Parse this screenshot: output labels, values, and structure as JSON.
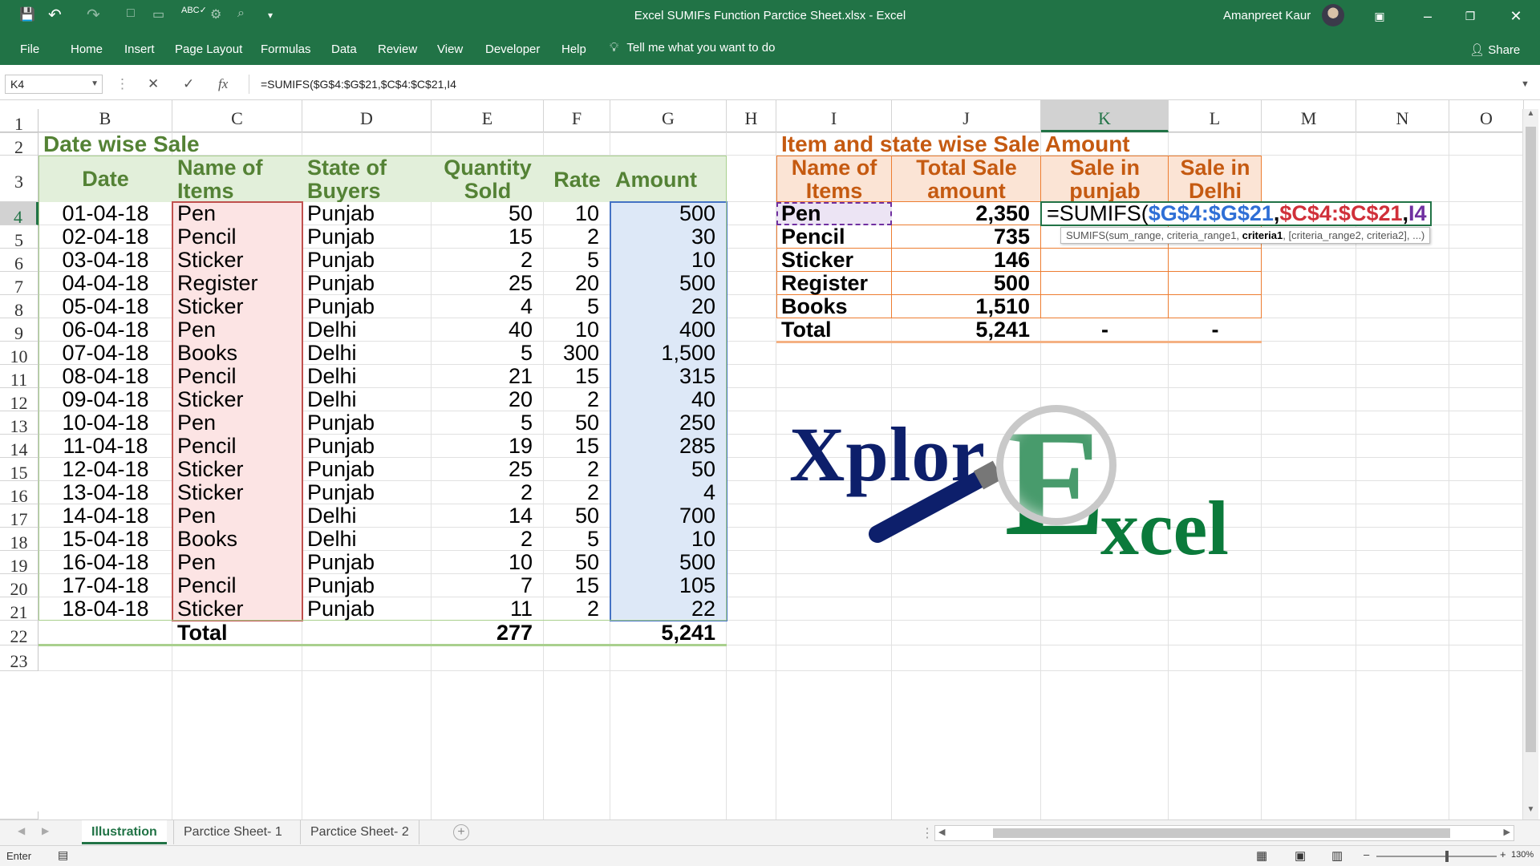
{
  "title_bar": {
    "doc_title": "Excel SUMIFs Function Parctice Sheet.xlsx  -  Excel",
    "user": "Amanpreet Kaur",
    "qa_save": "💾",
    "qa_undo": "↶",
    "qa_redo": "↷",
    "qa_more": "▾"
  },
  "ribbon": {
    "tabs": [
      "File",
      "Home",
      "Insert",
      "Page Layout",
      "Formulas",
      "Data",
      "Review",
      "View",
      "Developer",
      "Help"
    ],
    "tell_me": "Tell me what you want to do",
    "share": "Share"
  },
  "formula_bar": {
    "name_box": "K4",
    "formula": "=SUMIFS($G$4:$G$21,$C$4:$C$21,I4",
    "cancel": "✕",
    "enter": "✓",
    "fx": "fx"
  },
  "columns": [
    "B",
    "C",
    "D",
    "E",
    "F",
    "G",
    "H",
    "I",
    "J",
    "K",
    "L",
    "M",
    "N",
    "O"
  ],
  "rows": [
    "1",
    "2",
    "3",
    "4",
    "5",
    "6",
    "7",
    "8",
    "9",
    "10",
    "11",
    "12",
    "13",
    "14",
    "15",
    "16",
    "17",
    "18",
    "19",
    "20",
    "21",
    "22",
    "23"
  ],
  "left_table": {
    "title": "Date wise Sale",
    "headers": {
      "date": "Date",
      "items": "Name of Items",
      "state": "State of Buyers",
      "qty": "Quantity Sold",
      "rate": "Rate",
      "amount": "Amount"
    },
    "rows": [
      [
        "01-04-18",
        "Pen",
        "Punjab",
        "50",
        "10",
        "500"
      ],
      [
        "02-04-18",
        "Pencil",
        "Punjab",
        "15",
        "2",
        "30"
      ],
      [
        "03-04-18",
        "Sticker",
        "Punjab",
        "2",
        "5",
        "10"
      ],
      [
        "04-04-18",
        "Register",
        "Punjab",
        "25",
        "20",
        "500"
      ],
      [
        "05-04-18",
        "Sticker",
        "Punjab",
        "4",
        "5",
        "20"
      ],
      [
        "06-04-18",
        "Pen",
        "Delhi",
        "40",
        "10",
        "400"
      ],
      [
        "07-04-18",
        "Books",
        "Delhi",
        "5",
        "300",
        "1,500"
      ],
      [
        "08-04-18",
        "Pencil",
        "Delhi",
        "21",
        "15",
        "315"
      ],
      [
        "09-04-18",
        "Sticker",
        "Delhi",
        "20",
        "2",
        "40"
      ],
      [
        "10-04-18",
        "Pen",
        "Punjab",
        "5",
        "50",
        "250"
      ],
      [
        "11-04-18",
        "Pencil",
        "Punjab",
        "19",
        "15",
        "285"
      ],
      [
        "12-04-18",
        "Sticker",
        "Punjab",
        "25",
        "2",
        "50"
      ],
      [
        "13-04-18",
        "Sticker",
        "Punjab",
        "2",
        "2",
        "4"
      ],
      [
        "14-04-18",
        "Pen",
        "Delhi",
        "14",
        "50",
        "700"
      ],
      [
        "15-04-18",
        "Books",
        "Delhi",
        "2",
        "5",
        "10"
      ],
      [
        "16-04-18",
        "Pen",
        "Punjab",
        "10",
        "50",
        "500"
      ],
      [
        "17-04-18",
        "Pencil",
        "Punjab",
        "7",
        "15",
        "105"
      ],
      [
        "18-04-18",
        "Sticker",
        "Punjab",
        "11",
        "2",
        "22"
      ]
    ],
    "total_label": "Total",
    "total_qty": "277",
    "total_amount": "5,241"
  },
  "right_table": {
    "title": "Item and state wise Sale Amount",
    "headers": {
      "items": "Name of Items",
      "total": "Total Sale amount",
      "punjab": "Sale in punjab",
      "delhi": "Sale in Delhi"
    },
    "rows": [
      [
        "Pen",
        "2,350"
      ],
      [
        "Pencil",
        "735"
      ],
      [
        "Sticker",
        "146"
      ],
      [
        "Register",
        "500"
      ],
      [
        "Books",
        "1,510"
      ]
    ],
    "total_label": "Total",
    "total_amount": "5,241",
    "total_punjab": "-",
    "total_delhi": "-"
  },
  "edit": {
    "prefix": "=SUMIFS(",
    "arg1": "$G$4:$G$21",
    "sep1": ",",
    "arg2": "$C$4:$C$21",
    "sep2": ",",
    "arg3": "I4",
    "tooltip_pre": "SUMIFS(sum_range, criteria_range1, ",
    "tooltip_bold": "criteria1",
    "tooltip_post": ", [criteria_range2, criteria2], ...)"
  },
  "logo": {
    "part1": "Xplor",
    "part2": "E",
    "part3": "xcel"
  },
  "sheets": [
    "Illustration",
    "Parctice Sheet- 1",
    "Parctice Sheet- 2"
  ],
  "status": {
    "mode": "Enter",
    "zoom": "130%"
  },
  "colors": {
    "accent": "#217346",
    "green_text": "#548235",
    "orange_text": "#c55a11",
    "logo_navy": "#0d1f6b",
    "logo_green": "#0b7a3b"
  }
}
